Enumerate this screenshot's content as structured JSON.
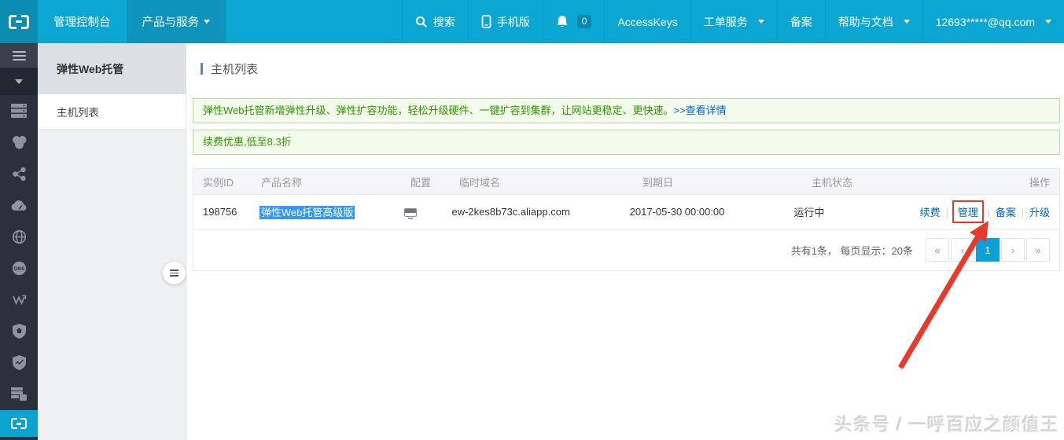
{
  "topbar": {
    "nav": {
      "console": "管理控制台",
      "products": "产品与服务"
    },
    "right": {
      "search": "搜索",
      "mobile": "手机版",
      "notification_badge": "0",
      "accesskeys": "AccessKeys",
      "tickets": "工单服务",
      "beian": "备案",
      "help": "帮助与文档",
      "account": "12693*****@qq.com"
    }
  },
  "sidebar": {
    "title": "弹性Web托管",
    "items": [
      {
        "label": "主机列表",
        "active": true
      }
    ]
  },
  "main": {
    "page_title": "主机列表",
    "banners": [
      {
        "text": "弹性Web托管新增弹性升级、弹性扩容功能，轻松升级硬件、一键扩容到集群，让网站更稳定、更快速。",
        "link": ">>查看详情"
      },
      {
        "text": "续费优惠,低至8.3折",
        "link": ""
      }
    ],
    "table": {
      "columns": [
        "实例ID",
        "产品名称",
        "配置",
        "临时域名",
        "到期日",
        "主机状态",
        "操作"
      ],
      "action_separator": "|",
      "rows": [
        {
          "instance_id": "198756",
          "product_name": "弹性Web托管高级版",
          "temp_domain": "ew-2kes8b73c.aliapp.com",
          "expire_date": "2017-05-30 00:00:00",
          "status": "运行中",
          "actions": [
            "续费",
            "管理",
            "备案",
            "升级"
          ]
        }
      ]
    },
    "pagination": {
      "summary": "共有1条， 每页显示：20条",
      "buttons": [
        "«",
        "‹",
        "1",
        "›",
        "»"
      ],
      "active_page": "1"
    }
  },
  "icons": {
    "dns_label": "DNS",
    "rail": [
      "menu-icon",
      "collapse-caret-icon",
      "servers-icon",
      "storage-cluster-icon",
      "share-nodes-icon",
      "cdn-cloud-icon",
      "globe-icon",
      "dns-icon",
      "trend-w-icon",
      "shield-home-icon",
      "shield-monitor-icon",
      "server-files-icon",
      "elastic-web-hosting-icon"
    ]
  },
  "annotation": {
    "type": "red-box-and-arrow",
    "target_action": "管理"
  },
  "watermark": "头条号 / 一呼百应之颜值王",
  "colors": {
    "topbar": "#0ca6d2",
    "topbar_active_tab": "#0e93bb",
    "logo_bg": "#0b8db2",
    "rail": "#2b313c",
    "rail_active": "#0ba3cf",
    "banner_text": "#2f9700",
    "banner_bg": "#f3fbec",
    "banner_border": "#b9dc9e",
    "link_blue": "#0066cc",
    "text_selection": "#3398fc",
    "pagination_active": "#0c9fd8",
    "annotation_red": "#e8392b"
  }
}
